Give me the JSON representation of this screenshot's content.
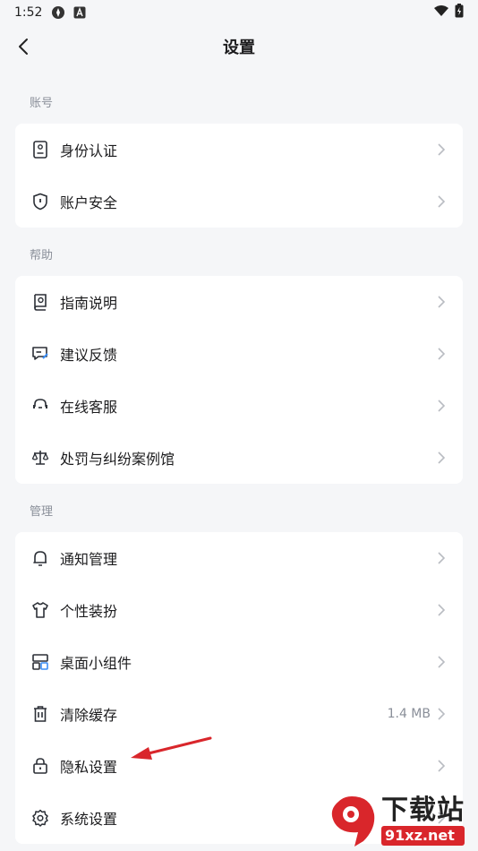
{
  "status_bar": {
    "time": "1:52"
  },
  "header": {
    "title": "设置"
  },
  "sections": {
    "account": {
      "label": "账号",
      "items": [
        {
          "label": "身份认证",
          "icon": "id-card-icon"
        },
        {
          "label": "账户安全",
          "icon": "shield-icon"
        }
      ]
    },
    "help": {
      "label": "帮助",
      "items": [
        {
          "label": "指南说明",
          "icon": "guide-book-icon"
        },
        {
          "label": "建议反馈",
          "icon": "feedback-icon"
        },
        {
          "label": "在线客服",
          "icon": "headset-icon"
        },
        {
          "label": "处罚与纠纷案例馆",
          "icon": "scale-icon"
        }
      ]
    },
    "manage": {
      "label": "管理",
      "items": [
        {
          "label": "通知管理",
          "icon": "bell-icon"
        },
        {
          "label": "个性装扮",
          "icon": "shirt-icon"
        },
        {
          "label": "桌面小组件",
          "icon": "widget-icon"
        },
        {
          "label": "清除缓存",
          "icon": "trash-icon",
          "value": "1.4 MB"
        },
        {
          "label": "隐私设置",
          "icon": "lock-icon"
        },
        {
          "label": "系统设置",
          "icon": "gear-icon"
        }
      ]
    }
  },
  "watermark": {
    "top": "下载站",
    "bottom": "91xz.net"
  },
  "colors": {
    "icon": "#2b2f36",
    "chevron": "#b9bcc2",
    "arrow": "#d9262b"
  }
}
